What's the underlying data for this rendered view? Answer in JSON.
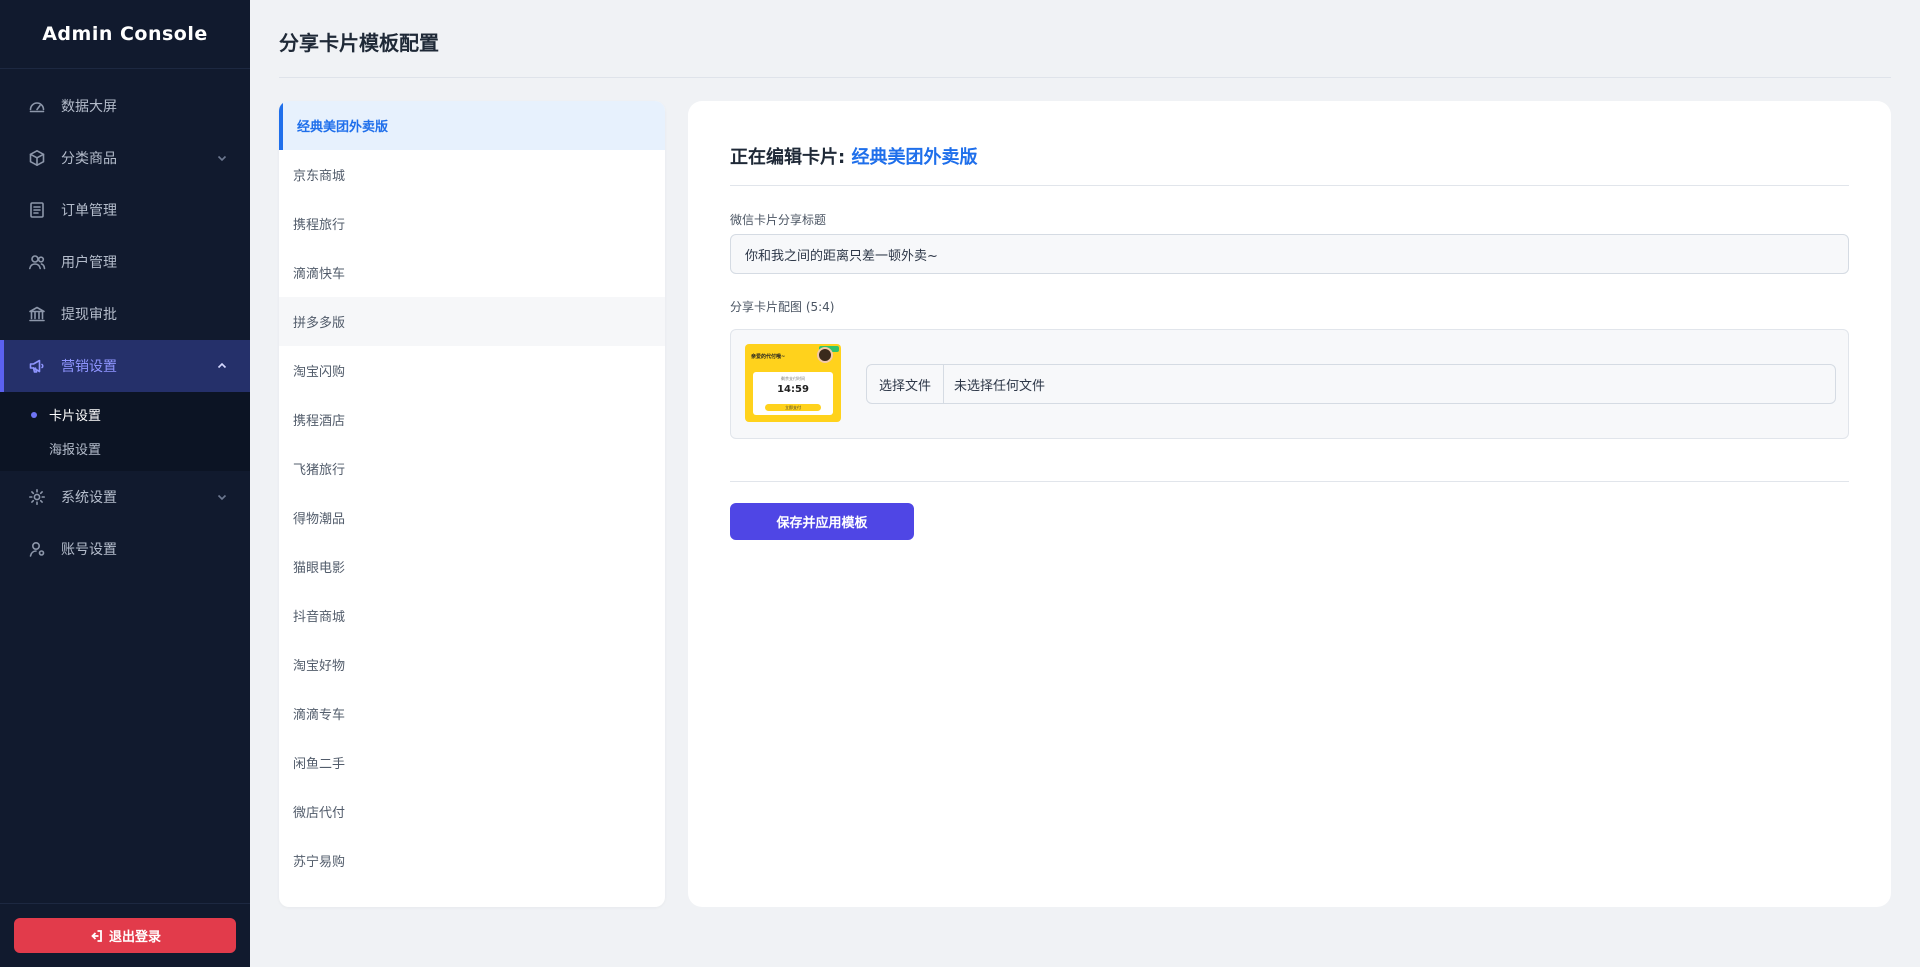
{
  "app": {
    "brand": "Admin Console"
  },
  "sidebar": {
    "items": [
      {
        "label": "数据大屏",
        "icon": "dashboard-icon"
      },
      {
        "label": "分类商品",
        "icon": "box-icon",
        "expandable": true
      },
      {
        "label": "订单管理",
        "icon": "order-icon"
      },
      {
        "label": "用户管理",
        "icon": "users-icon"
      },
      {
        "label": "提现审批",
        "icon": "bank-icon"
      },
      {
        "label": "营销设置",
        "icon": "megaphone-icon",
        "expandable": true,
        "active": true
      },
      {
        "label": "系统设置",
        "icon": "gear-icon",
        "expandable": true
      },
      {
        "label": "账号设置",
        "icon": "account-icon"
      }
    ],
    "submenu": [
      {
        "label": "卡片设置",
        "active": true
      },
      {
        "label": "海报设置"
      }
    ],
    "logout_label": "退出登录"
  },
  "page": {
    "title": "分享卡片模板配置"
  },
  "templates": {
    "items": [
      "经典美团外卖版",
      "京东商城",
      "携程旅行",
      "滴滴快车",
      "拼多多版",
      "淘宝闪购",
      "携程酒店",
      "飞猪旅行",
      "得物潮品",
      "猫眼电影",
      "抖音商城",
      "淘宝好物",
      "滴滴专车",
      "闲鱼二手",
      "微店代付",
      "苏宁易购"
    ],
    "active_index": 0,
    "hover_index": 4
  },
  "editor": {
    "heading_prefix": "正在编辑卡片:",
    "current_template": "经典美团外卖版",
    "share_title_label": "微信卡片分享标题",
    "share_title_value": "你和我之间的距离只差一顿外卖~",
    "image_label": "分享卡片配图 (5:4)",
    "thumbnail": {
      "headline": "亲爱的代付哦~",
      "subtext": "剩余支付时间",
      "time": "14:59",
      "button": "立即支付"
    },
    "file_button": "选择文件",
    "file_status": "未选择任何文件",
    "save_label": "保存并应用模板"
  },
  "colors": {
    "sidebar_bg": "#111a2e",
    "accent": "#4f46e5",
    "active_blue": "#1f6feb",
    "logout_red": "#e23b4b",
    "thumb_yellow": "#ffd21c"
  }
}
